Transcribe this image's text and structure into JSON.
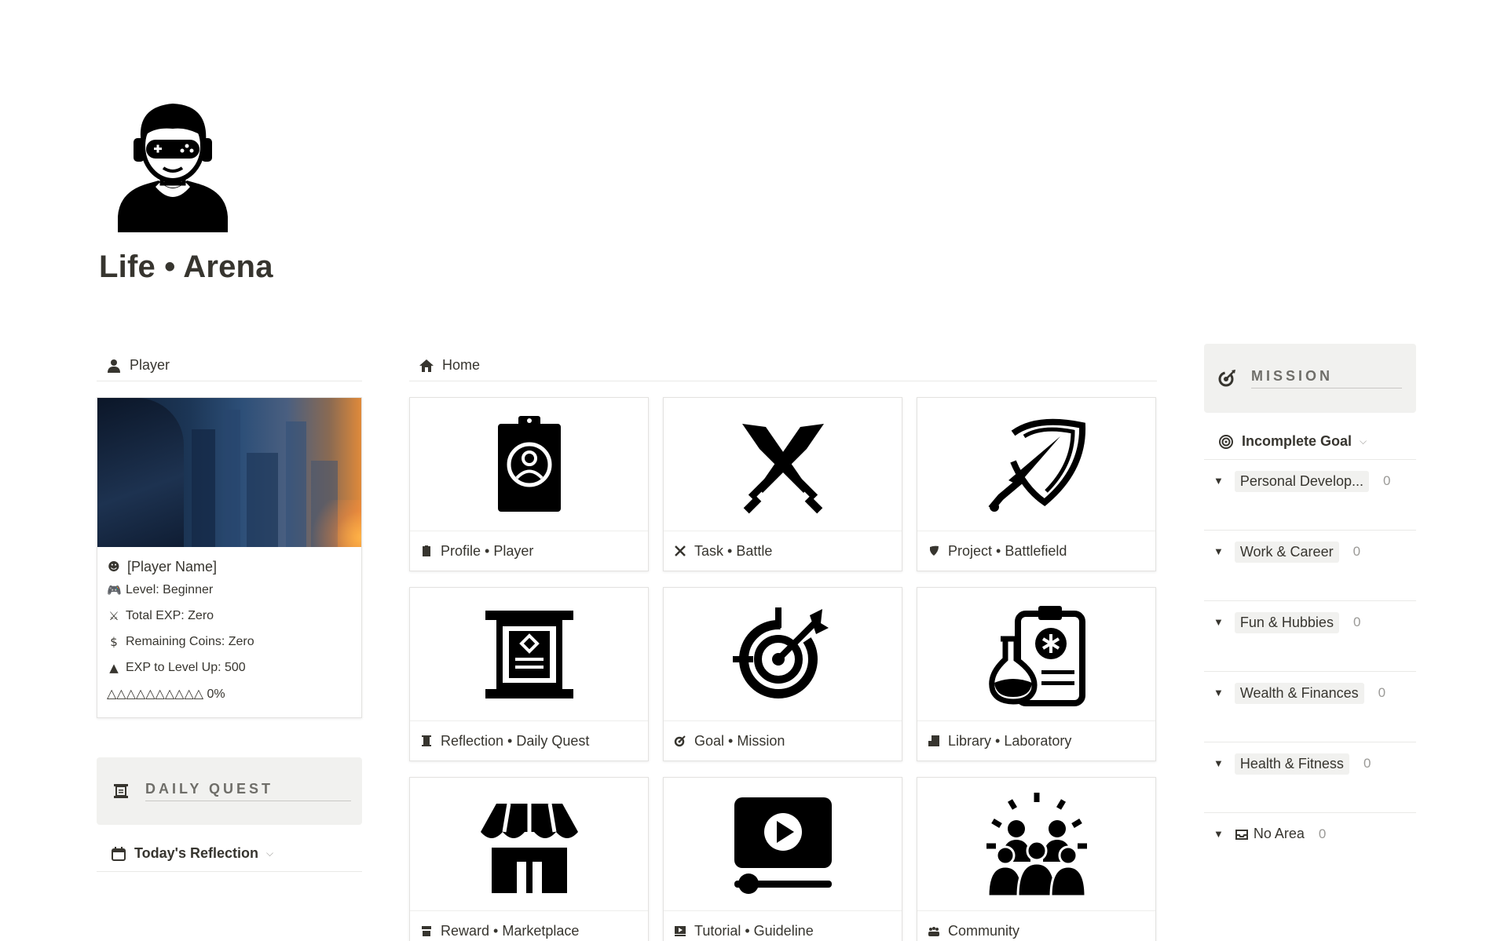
{
  "page": {
    "title": "Life • Arena",
    "icon": "gamer-avatar-icon"
  },
  "player": {
    "header": "Player",
    "name": "[Player Name]",
    "level": "Level: Beginner",
    "total_exp": "Total EXP: Zero",
    "coins": "Remaining Coins: Zero",
    "exp_to_level": "EXP to Level Up: 500",
    "progress": "△△△△△△△△△△ 0%",
    "progress_value": 0
  },
  "daily_quest": {
    "title": "DAILY QUEST",
    "view": "Today's Reflection"
  },
  "home": {
    "header": "Home",
    "cards": [
      {
        "label": "Profile • Player",
        "icon": "profile-clipboard-icon"
      },
      {
        "label": "Task • Battle",
        "icon": "crossed-swords-icon"
      },
      {
        "label": "Project • Battlefield",
        "icon": "shield-sword-icon"
      },
      {
        "label": "Reflection • Daily Quest",
        "icon": "scroll-icon"
      },
      {
        "label": "Goal • Mission",
        "icon": "target-icon"
      },
      {
        "label": "Library • Laboratory",
        "icon": "lab-flask-icon"
      },
      {
        "label": "Reward • Marketplace",
        "icon": "store-icon"
      },
      {
        "label": "Tutorial  • Guideline",
        "icon": "video-player-icon"
      },
      {
        "label": "Community",
        "icon": "community-icon"
      }
    ]
  },
  "mission": {
    "title": "MISSION",
    "view": "Incomplete Goal",
    "groups": [
      {
        "label": "Personal Develop...",
        "count": "0"
      },
      {
        "label": "Work & Career",
        "count": "0"
      },
      {
        "label": "Fun & Hubbies",
        "count": "0"
      },
      {
        "label": "Wealth & Finances",
        "count": "0"
      },
      {
        "label": "Health & Fitness",
        "count": "0"
      },
      {
        "label": "No Area",
        "count": "0"
      }
    ]
  },
  "colors": {
    "text": "#37352f",
    "muted": "#9b9a97",
    "callout_bg": "#f1f1ef",
    "border": "#e9e9e7"
  }
}
